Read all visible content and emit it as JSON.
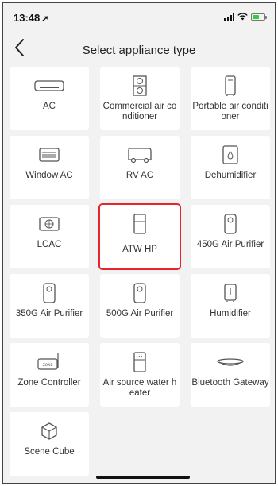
{
  "status_bar": {
    "time": "13:48",
    "location_icon": "location-arrow-icon",
    "battery_color": "#3ec73e"
  },
  "header": {
    "back_icon": "chevron-left-icon",
    "title": "Select appliance type"
  },
  "selection": {
    "selected_item": "ATW HP",
    "highlight_color": "#e3262b"
  },
  "appliances": [
    {
      "label": "AC",
      "icon": "wall-ac-icon"
    },
    {
      "label": "Commercial air conditioner",
      "icon": "commercial-ac-icon"
    },
    {
      "label": "Portable air conditioner",
      "icon": "portable-ac-icon"
    },
    {
      "label": "Window AC",
      "icon": "window-ac-icon"
    },
    {
      "label": "RV AC",
      "icon": "rv-ac-icon"
    },
    {
      "label": "Dehumidifier",
      "icon": "dehumidifier-icon"
    },
    {
      "label": "LCAC",
      "icon": "lcac-icon"
    },
    {
      "label": "ATW HP",
      "icon": "atw-hp-icon"
    },
    {
      "label": "450G Air Purifier",
      "icon": "air-purifier-icon"
    },
    {
      "label": "350G Air Purifier",
      "icon": "air-purifier-icon"
    },
    {
      "label": "500G Air Purifier",
      "icon": "air-purifier-icon"
    },
    {
      "label": "Humidifier",
      "icon": "humidifier-icon"
    },
    {
      "label": "Zone Controller",
      "icon": "zone-controller-icon"
    },
    {
      "label": "Air source water heater",
      "icon": "water-heater-icon"
    },
    {
      "label": "Bluetooth Gateway",
      "icon": "bluetooth-gateway-icon"
    },
    {
      "label": "Scene Cube",
      "icon": "cube-icon"
    }
  ],
  "zone_icon_text": "ZONE"
}
